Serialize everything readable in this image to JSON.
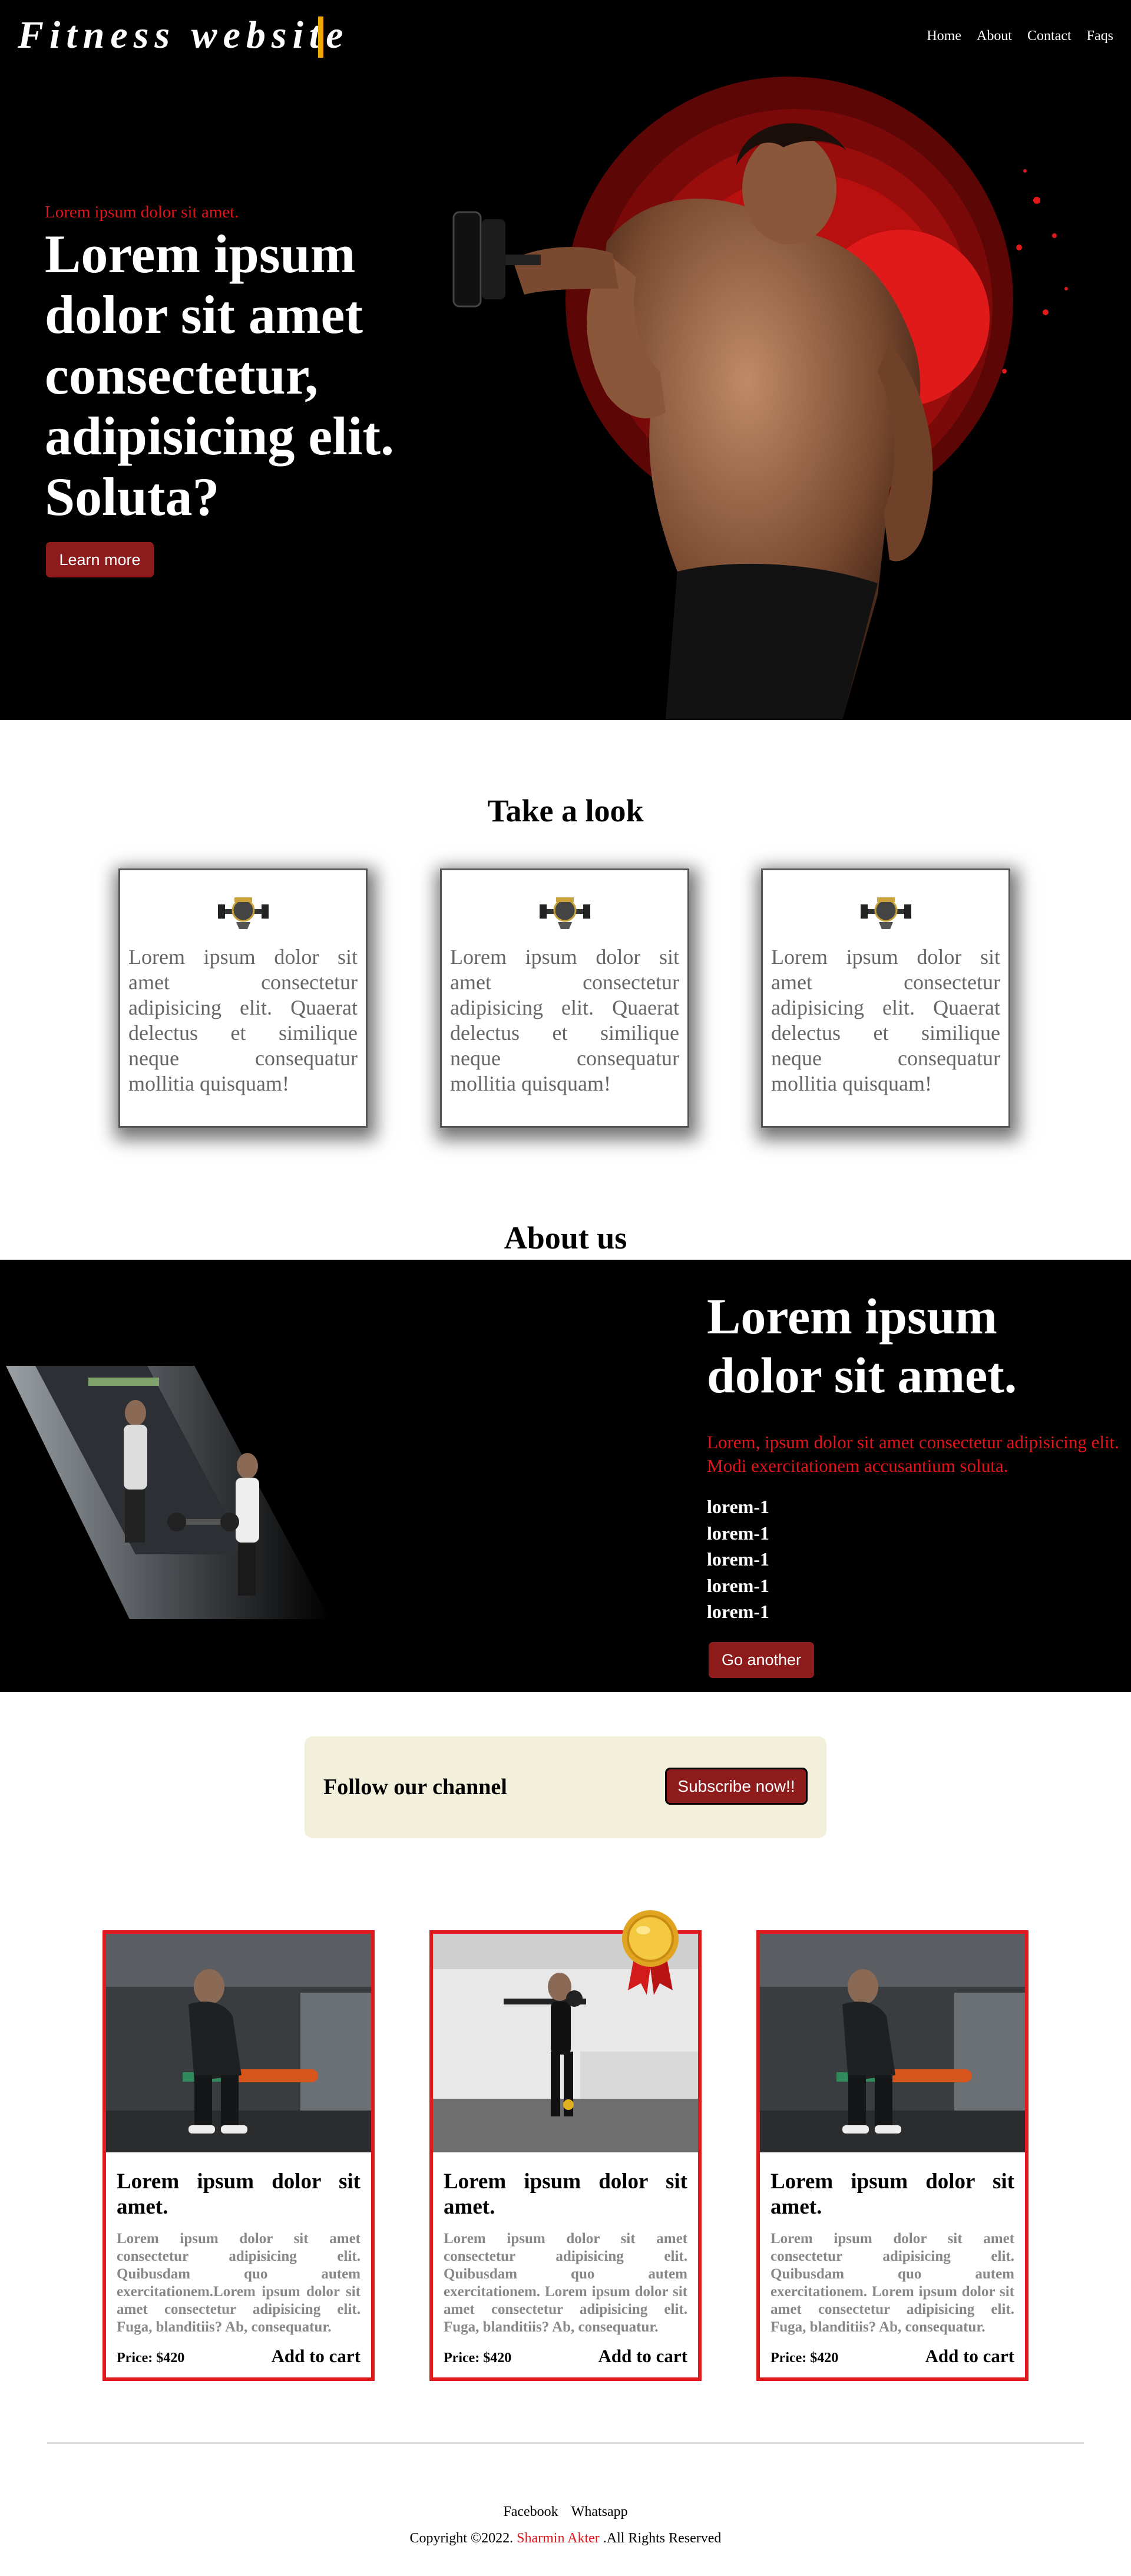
{
  "header": {
    "brand": "Fitness website",
    "nav": [
      "Home",
      "About",
      "Contact",
      "Faqs"
    ]
  },
  "hero": {
    "kicker": "Lorem ipsum dolor sit amet.",
    "title": "Lorem ipsum dolor sit amet consectetur, adipisicing elit. Soluta?",
    "cta": "Learn more"
  },
  "take_a_look": {
    "title": "Take a look",
    "cards": [
      {
        "text": "Lorem ipsum dolor sit amet consectetur adipisicing elit. Quaerat delectus et similique neque consequatur mollitia quisquam!"
      },
      {
        "text": "Lorem ipsum dolor sit amet consectetur adipisicing elit. Quaerat delectus et similique neque consequatur mollitia quisquam!"
      },
      {
        "text": "Lorem ipsum dolor sit amet consectetur adipisicing elit. Quaerat delectus et similique neque consequatur mollitia quisquam!"
      }
    ]
  },
  "about": {
    "title": "About us",
    "heading": "Lorem ipsum dolor sit amet.",
    "text": "Lorem, ipsum dolor sit amet consectetur adipisicing elit. Modi exercitationem accusantium soluta.",
    "list": [
      "lorem-1",
      "lorem-1",
      "lorem-1",
      "lorem-1",
      "lorem-1"
    ],
    "cta": "Go another"
  },
  "subscribe": {
    "label": "Follow our channel",
    "button": "Subscribe now!!"
  },
  "products": [
    {
      "title": "Lorem ipsum dolor sit amet.",
      "desc": "Lorem ipsum dolor sit amet consectetur adipisicing elit. Quibusdam quo autem exercitationem.Lorem ipsum dolor sit amet consectetur adipisicing elit. Fuga, blanditiis? Ab, consequatur.",
      "price": "Price: $420",
      "cart": "Add to cart"
    },
    {
      "title": "Lorem ipsum dolor sit amet.",
      "desc": "Lorem ipsum dolor sit amet consectetur adipisicing elit. Quibusdam quo autem exercitationem. Lorem ipsum dolor sit amet consectetur adipisicing elit. Fuga, blanditiis? Ab, consequatur.",
      "price": "Price: $420",
      "cart": "Add to cart"
    },
    {
      "title": "Lorem ipsum dolor sit amet.",
      "desc": "Lorem ipsum dolor sit amet consectetur adipisicing elit. Quibusdam quo autem exercitationem. Lorem ipsum dolor sit amet consectetur adipisicing elit. Fuga, blanditiis? Ab, consequatur.",
      "price": "Price: $420",
      "cart": "Add to cart"
    }
  ],
  "footer": {
    "links": [
      "Facebook",
      "Whatsapp"
    ],
    "copyright_prefix": "Copyright ©2022.",
    "author": "Sharmin Akter",
    "copyright_suffix": ".All Rights Reserved"
  },
  "colors": {
    "accent_red": "#e0141a",
    "button_red": "#8e1b1b",
    "cursor_gold": "#f0a900",
    "subscribe_bg": "#f2f0da"
  }
}
